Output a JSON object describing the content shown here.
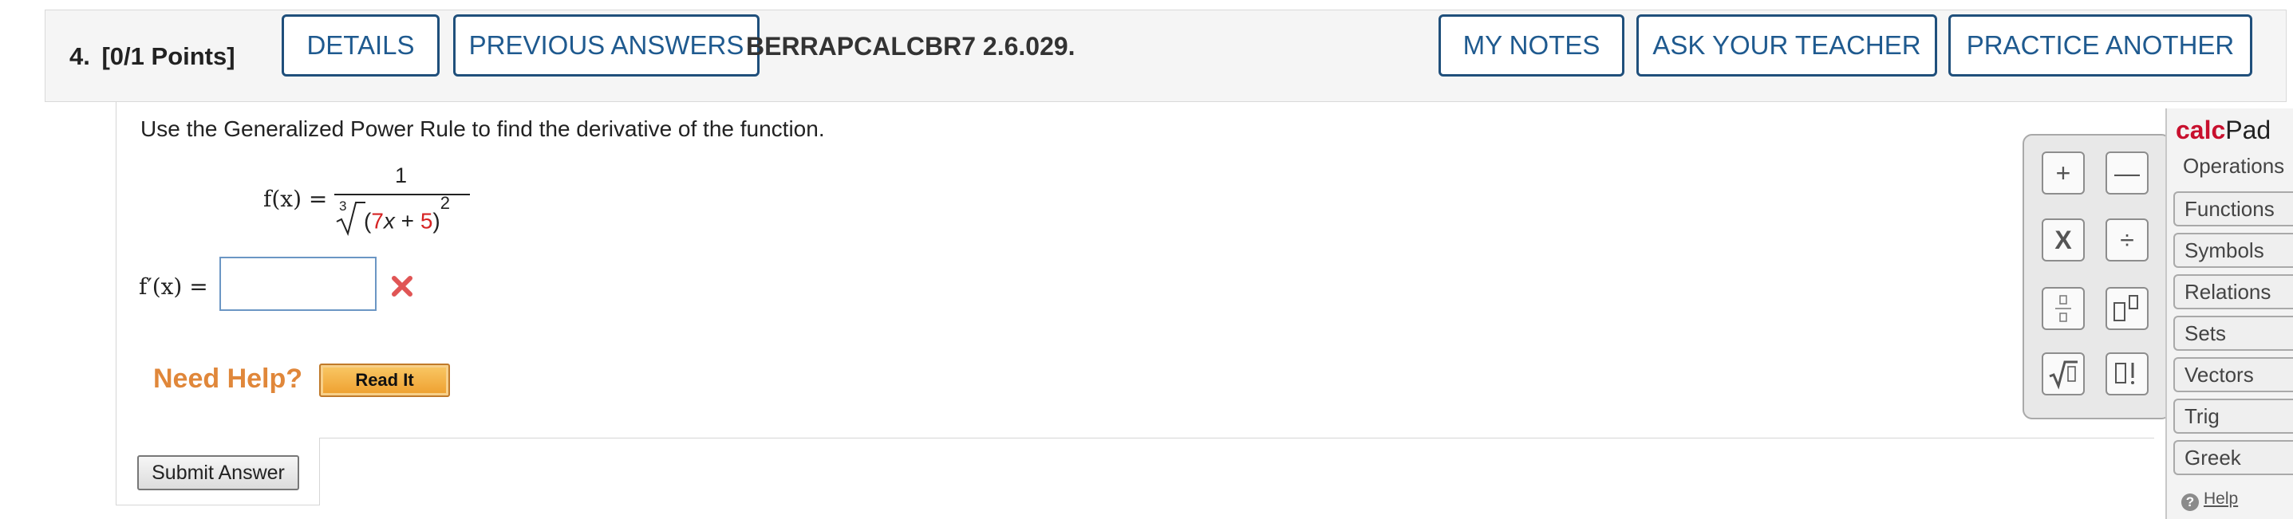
{
  "header": {
    "number": "4.",
    "points": "[0/1 Points]",
    "details_label": "DETAILS",
    "previous_answers_label": "PREVIOUS ANSWERS",
    "code": "BERRAPCALCBR7 2.6.029.",
    "my_notes_label": "MY NOTES",
    "ask_teacher_label": "ASK YOUR TEACHER",
    "practice_another_label": "PRACTICE ANOTHER"
  },
  "question": {
    "prompt": "Use the Generalized Power Rule to find the derivative of the function.",
    "function_lhs": "f(x) =",
    "numerator": "1",
    "root_index": "3",
    "denominator_open": "(",
    "coefficient": "7",
    "variable": "x",
    "plus": " + ",
    "constant": "5",
    "denominator_close": ")",
    "exponent": "2",
    "answer_lhs": "f′(x) =",
    "answer_value": "",
    "answer_status": "incorrect",
    "status_color": "#e05555"
  },
  "help": {
    "label": "Need Help?",
    "read_it_label": "Read It"
  },
  "submit_label": "Submit Answer",
  "calcpad": {
    "title_calc": "calc",
    "title_pad": "Pad",
    "keys": {
      "plus": "+",
      "minus": "—",
      "times": "X",
      "divide": "÷",
      "power": "▯▯",
      "factorial": "▯!"
    },
    "tabs": [
      "Operations",
      "Functions",
      "Symbols",
      "Relations",
      "Sets",
      "Vectors",
      "Trig",
      "Greek"
    ],
    "help_label": "Help"
  },
  "colors": {
    "accent_blue": "#1f5a8f",
    "highlight_red": "#d62323",
    "help_orange": "#e0873a"
  }
}
